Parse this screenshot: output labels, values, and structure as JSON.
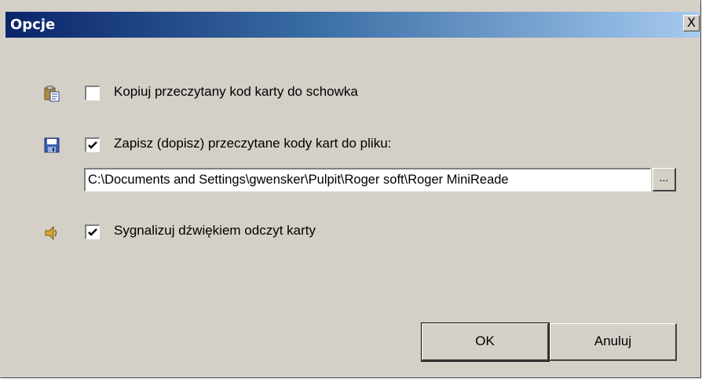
{
  "window": {
    "title": "Opcje",
    "close_label": "X"
  },
  "options": {
    "copy_to_clipboard": {
      "label": "Kopiuj przeczytany kod karty do schowka",
      "checked": false,
      "icon": "clipboard-icon"
    },
    "save_to_file": {
      "label": "Zapisz (dopisz) przeczytane kody kart do pliku:",
      "checked": true,
      "icon": "floppy-disk-icon",
      "path": "C:\\Documents and Settings\\gwensker\\Pulpit\\Roger soft\\Roger MiniReade",
      "browse_label": "..."
    },
    "sound_signal": {
      "label": "Sygnalizuj dźwiękiem odczyt karty",
      "checked": true,
      "icon": "speaker-icon"
    }
  },
  "buttons": {
    "ok": "OK",
    "cancel": "Anuluj"
  }
}
